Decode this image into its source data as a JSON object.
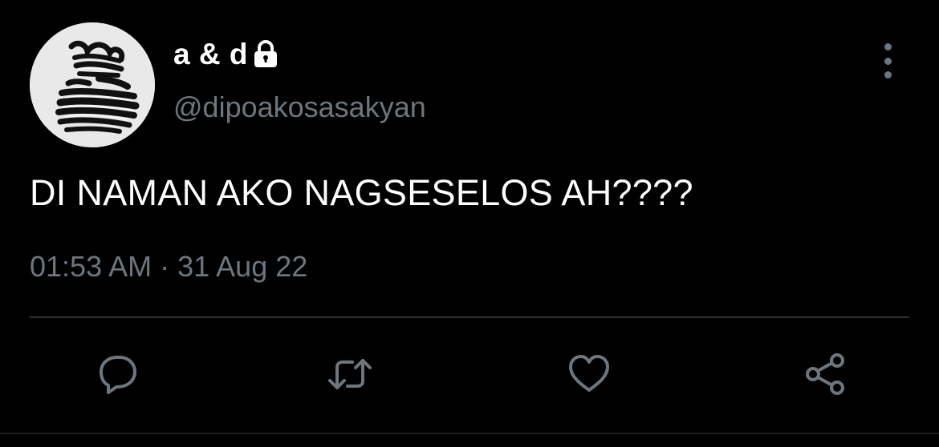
{
  "tweet": {
    "display_name": "a & d",
    "username": "@dipoakosasakyan",
    "text": "DI NAMAN AKO NAGSESELOS AH????",
    "timestamp": "01:53 AM · 31 Aug 22",
    "protected_icon": "lock-icon",
    "avatar_icon": "abstract-figure-avatar"
  },
  "actions": [
    {
      "name": "reply",
      "icon": "speech-bubble-icon"
    },
    {
      "name": "retweet",
      "icon": "retweet-arrows-icon"
    },
    {
      "name": "like",
      "icon": "heart-icon"
    },
    {
      "name": "share",
      "icon": "share-nodes-icon"
    }
  ],
  "more_icon": "vertical-ellipsis-icon",
  "colors": {
    "background": "#000000",
    "primary_text": "#ffffff",
    "secondary_text": "#6e767d",
    "divider": "#2f3336",
    "avatar_bg": "#e9e9e9"
  }
}
